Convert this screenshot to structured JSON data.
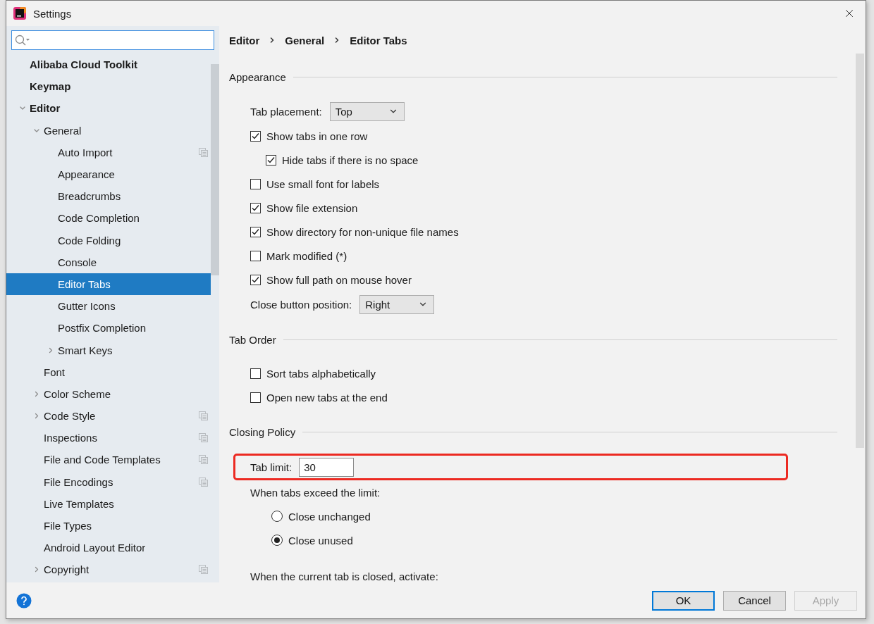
{
  "window": {
    "title": "Settings"
  },
  "tree": [
    {
      "label": "Alibaba Cloud Toolkit",
      "selected": false
    },
    {
      "label": "Keymap",
      "selected": false
    },
    {
      "label": "Editor",
      "selected": false,
      "expanded": true,
      "children": [
        {
          "label": "General",
          "selected": false,
          "expanded": true,
          "children": [
            {
              "label": "Auto Import",
              "selected": false,
              "scoped": true
            },
            {
              "label": "Appearance",
              "selected": false
            },
            {
              "label": "Breadcrumbs",
              "selected": false
            },
            {
              "label": "Code Completion",
              "selected": false
            },
            {
              "label": "Code Folding",
              "selected": false
            },
            {
              "label": "Console",
              "selected": false
            },
            {
              "label": "Editor Tabs",
              "selected": true
            },
            {
              "label": "Gutter Icons",
              "selected": false
            },
            {
              "label": "Postfix Completion",
              "selected": false
            },
            {
              "label": "Smart Keys",
              "selected": false,
              "expanded": false
            }
          ]
        },
        {
          "label": "Font",
          "selected": false
        },
        {
          "label": "Color Scheme",
          "selected": false,
          "expanded": false
        },
        {
          "label": "Code Style",
          "selected": false,
          "expanded": false,
          "scoped": true
        },
        {
          "label": "Inspections",
          "selected": false,
          "scoped": true
        },
        {
          "label": "File and Code Templates",
          "selected": false,
          "scoped": true
        },
        {
          "label": "File Encodings",
          "selected": false,
          "scoped": true
        },
        {
          "label": "Live Templates",
          "selected": false
        },
        {
          "label": "File Types",
          "selected": false
        },
        {
          "label": "Android Layout Editor",
          "selected": false
        },
        {
          "label": "Copyright",
          "selected": false,
          "expanded": false,
          "scoped": true
        }
      ]
    }
  ],
  "breadcrumb": [
    "Editor",
    "General",
    "Editor Tabs"
  ],
  "sections": [
    {
      "title": "Appearance",
      "items": [
        {
          "kind": "select",
          "label": "Tab placement:",
          "value": "Top"
        },
        {
          "kind": "checkbox",
          "label": "Show tabs in one row",
          "checked": true,
          "children": [
            {
              "kind": "checkbox",
              "label": "Hide tabs if there is no space",
              "checked": true
            }
          ]
        },
        {
          "kind": "checkbox",
          "label": "Use small font for labels",
          "checked": false
        },
        {
          "kind": "checkbox",
          "label": "Show file extension",
          "checked": true
        },
        {
          "kind": "checkbox",
          "label": "Show directory for non-unique file names",
          "checked": true
        },
        {
          "kind": "checkbox",
          "label": "Mark modified (*)",
          "checked": false
        },
        {
          "kind": "checkbox",
          "label": "Show full path on mouse hover",
          "checked": true
        },
        {
          "kind": "select",
          "label": "Close button position:",
          "value": "Right"
        }
      ]
    },
    {
      "title": "Tab Order",
      "items": [
        {
          "kind": "checkbox",
          "label": "Sort tabs alphabetically",
          "checked": false
        },
        {
          "kind": "checkbox",
          "label": "Open new tabs at the end",
          "checked": false
        }
      ]
    },
    {
      "title": "Closing Policy",
      "items": [
        {
          "kind": "input",
          "label": "Tab limit:",
          "value": "30",
          "highlighted": true
        },
        {
          "kind": "label",
          "label": "When tabs exceed the limit:",
          "children": [
            {
              "kind": "radio",
              "label": "Close unchanged",
              "selected": false
            },
            {
              "kind": "radio",
              "label": "Close unused",
              "selected": true
            }
          ]
        },
        {
          "kind": "label",
          "label": "When the current tab is closed, activate:"
        }
      ]
    }
  ],
  "buttons": [
    {
      "label": "OK",
      "default": true,
      "disabled": false
    },
    {
      "label": "Cancel",
      "default": false,
      "disabled": false
    },
    {
      "label": "Apply",
      "default": false,
      "disabled": true
    }
  ]
}
